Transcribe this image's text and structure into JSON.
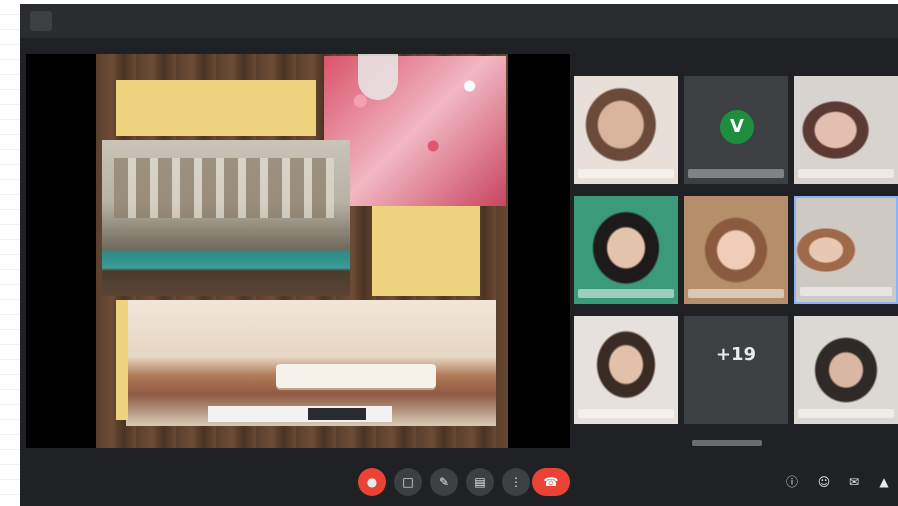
{
  "window": {
    "title": ""
  },
  "participants": [
    {
      "name": "",
      "kind": "video"
    },
    {
      "name": "",
      "kind": "avatar",
      "initial": "V"
    },
    {
      "name": "",
      "kind": "video"
    },
    {
      "name": "",
      "kind": "video"
    },
    {
      "name": "",
      "kind": "video"
    },
    {
      "name": "",
      "kind": "video"
    },
    {
      "name": "",
      "kind": "video"
    },
    {
      "name": "",
      "kind": "more",
      "count": "+19",
      "label": ""
    },
    {
      "name": "",
      "kind": "video"
    }
  ],
  "controls": {
    "time": "",
    "buttons": [
      "mic-off-icon",
      "camera-icon",
      "captions-icon",
      "present-icon",
      "more-icon",
      "end-call-icon"
    ]
  },
  "side_icons": [
    "info-icon",
    "people-icon",
    "chat-icon",
    "activities-icon"
  ],
  "colors": {
    "bg": "#202124",
    "accent": "#ea4335",
    "note": "#efd27d",
    "avatar": "#1e8e3e"
  }
}
